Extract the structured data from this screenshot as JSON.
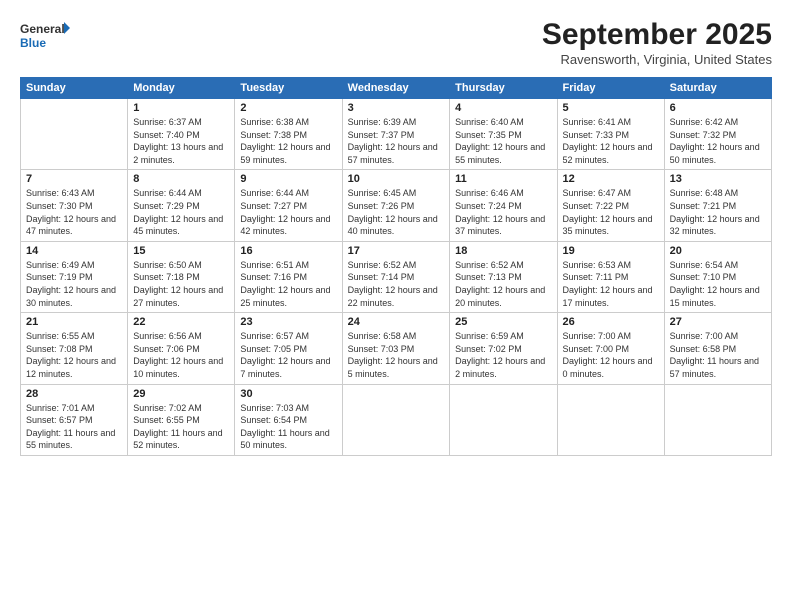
{
  "header": {
    "logo_general": "General",
    "logo_blue": "Blue",
    "month_title": "September 2025",
    "location": "Ravensworth, Virginia, United States"
  },
  "weekdays": [
    "Sunday",
    "Monday",
    "Tuesday",
    "Wednesday",
    "Thursday",
    "Friday",
    "Saturday"
  ],
  "weeks": [
    [
      {
        "day": null
      },
      {
        "day": "1",
        "sunrise": "6:37 AM",
        "sunset": "7:40 PM",
        "daylight": "13 hours and 2 minutes."
      },
      {
        "day": "2",
        "sunrise": "6:38 AM",
        "sunset": "7:38 PM",
        "daylight": "12 hours and 59 minutes."
      },
      {
        "day": "3",
        "sunrise": "6:39 AM",
        "sunset": "7:37 PM",
        "daylight": "12 hours and 57 minutes."
      },
      {
        "day": "4",
        "sunrise": "6:40 AM",
        "sunset": "7:35 PM",
        "daylight": "12 hours and 55 minutes."
      },
      {
        "day": "5",
        "sunrise": "6:41 AM",
        "sunset": "7:33 PM",
        "daylight": "12 hours and 52 minutes."
      },
      {
        "day": "6",
        "sunrise": "6:42 AM",
        "sunset": "7:32 PM",
        "daylight": "12 hours and 50 minutes."
      }
    ],
    [
      {
        "day": "7",
        "sunrise": "6:43 AM",
        "sunset": "7:30 PM",
        "daylight": "12 hours and 47 minutes."
      },
      {
        "day": "8",
        "sunrise": "6:44 AM",
        "sunset": "7:29 PM",
        "daylight": "12 hours and 45 minutes."
      },
      {
        "day": "9",
        "sunrise": "6:44 AM",
        "sunset": "7:27 PM",
        "daylight": "12 hours and 42 minutes."
      },
      {
        "day": "10",
        "sunrise": "6:45 AM",
        "sunset": "7:26 PM",
        "daylight": "12 hours and 40 minutes."
      },
      {
        "day": "11",
        "sunrise": "6:46 AM",
        "sunset": "7:24 PM",
        "daylight": "12 hours and 37 minutes."
      },
      {
        "day": "12",
        "sunrise": "6:47 AM",
        "sunset": "7:22 PM",
        "daylight": "12 hours and 35 minutes."
      },
      {
        "day": "13",
        "sunrise": "6:48 AM",
        "sunset": "7:21 PM",
        "daylight": "12 hours and 32 minutes."
      }
    ],
    [
      {
        "day": "14",
        "sunrise": "6:49 AM",
        "sunset": "7:19 PM",
        "daylight": "12 hours and 30 minutes."
      },
      {
        "day": "15",
        "sunrise": "6:50 AM",
        "sunset": "7:18 PM",
        "daylight": "12 hours and 27 minutes."
      },
      {
        "day": "16",
        "sunrise": "6:51 AM",
        "sunset": "7:16 PM",
        "daylight": "12 hours and 25 minutes."
      },
      {
        "day": "17",
        "sunrise": "6:52 AM",
        "sunset": "7:14 PM",
        "daylight": "12 hours and 22 minutes."
      },
      {
        "day": "18",
        "sunrise": "6:52 AM",
        "sunset": "7:13 PM",
        "daylight": "12 hours and 20 minutes."
      },
      {
        "day": "19",
        "sunrise": "6:53 AM",
        "sunset": "7:11 PM",
        "daylight": "12 hours and 17 minutes."
      },
      {
        "day": "20",
        "sunrise": "6:54 AM",
        "sunset": "7:10 PM",
        "daylight": "12 hours and 15 minutes."
      }
    ],
    [
      {
        "day": "21",
        "sunrise": "6:55 AM",
        "sunset": "7:08 PM",
        "daylight": "12 hours and 12 minutes."
      },
      {
        "day": "22",
        "sunrise": "6:56 AM",
        "sunset": "7:06 PM",
        "daylight": "12 hours and 10 minutes."
      },
      {
        "day": "23",
        "sunrise": "6:57 AM",
        "sunset": "7:05 PM",
        "daylight": "12 hours and 7 minutes."
      },
      {
        "day": "24",
        "sunrise": "6:58 AM",
        "sunset": "7:03 PM",
        "daylight": "12 hours and 5 minutes."
      },
      {
        "day": "25",
        "sunrise": "6:59 AM",
        "sunset": "7:02 PM",
        "daylight": "12 hours and 2 minutes."
      },
      {
        "day": "26",
        "sunrise": "7:00 AM",
        "sunset": "7:00 PM",
        "daylight": "12 hours and 0 minutes."
      },
      {
        "day": "27",
        "sunrise": "7:00 AM",
        "sunset": "6:58 PM",
        "daylight": "11 hours and 57 minutes."
      }
    ],
    [
      {
        "day": "28",
        "sunrise": "7:01 AM",
        "sunset": "6:57 PM",
        "daylight": "11 hours and 55 minutes."
      },
      {
        "day": "29",
        "sunrise": "7:02 AM",
        "sunset": "6:55 PM",
        "daylight": "11 hours and 52 minutes."
      },
      {
        "day": "30",
        "sunrise": "7:03 AM",
        "sunset": "6:54 PM",
        "daylight": "11 hours and 50 minutes."
      },
      {
        "day": null
      },
      {
        "day": null
      },
      {
        "day": null
      },
      {
        "day": null
      }
    ]
  ]
}
